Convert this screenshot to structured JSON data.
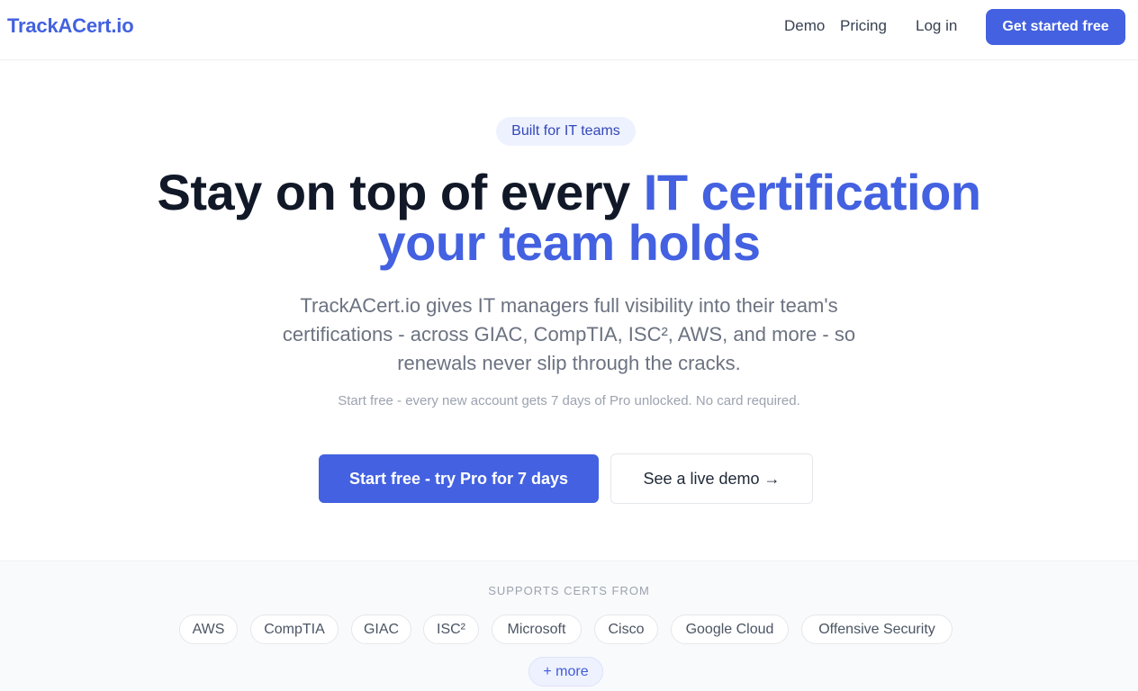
{
  "header": {
    "logo": "TrackACert.io",
    "nav": {
      "demo": "Demo",
      "pricing": "Pricing",
      "login": "Log in"
    },
    "cta": "Get started free"
  },
  "hero": {
    "badge": "Built for IT teams",
    "headline_plain": "Stay on top of every ",
    "headline_accent_1": "IT certification",
    "headline_accent_2": "your team holds",
    "subhead": "TrackACert.io gives IT managers full visibility into their team's certifications - across GIAC, CompTIA, ISC², AWS, and more - so renewals never slip through the cracks.",
    "note": "Start free - every new account gets 7 days of Pro unlocked. No card required.",
    "primary_button": "Start free - try Pro for 7 days",
    "secondary_button": "See a live demo →"
  },
  "certs": {
    "heading": "SUPPORTS CERTS FROM",
    "items": [
      "AWS",
      "CompTIA",
      "GIAC",
      "ISC²",
      "Microsoft",
      "Cisco",
      "Google Cloud",
      "Offensive Security"
    ],
    "more": "+ more"
  },
  "colors": {
    "accent": "#4361e0",
    "text_dark": "#111827",
    "text_muted": "#6b7280"
  }
}
